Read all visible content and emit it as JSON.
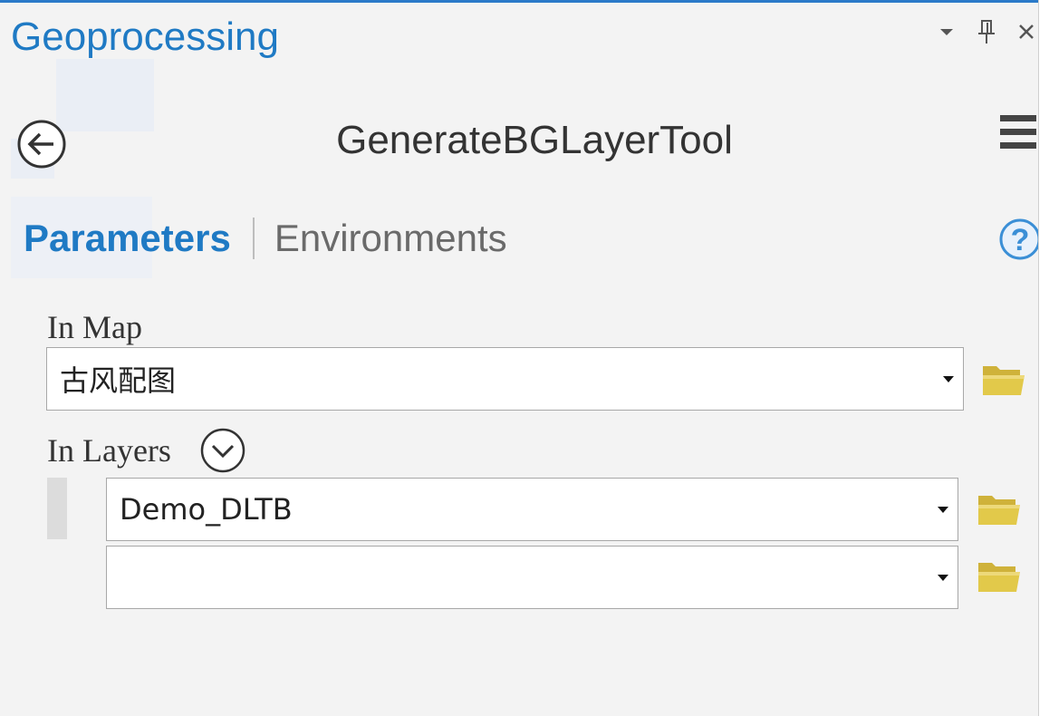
{
  "pane": {
    "title": "Geoprocessing",
    "controls": {
      "auto_hide_icon": "chevron-down-icon",
      "pin_icon": "pin-icon",
      "close_icon": "close-icon"
    },
    "accent_color": "#1f7ac4"
  },
  "tool": {
    "name": "GenerateBGLayerTool",
    "back_icon": "back-arrow-icon",
    "menu_icon": "hamburger-menu-icon"
  },
  "tabs": {
    "parameters_label": "Parameters",
    "environments_label": "Environments",
    "active": "Parameters",
    "help_icon": "help-icon"
  },
  "parameters": {
    "in_map": {
      "label": "In Map",
      "value": "古风配图"
    },
    "in_layers": {
      "label": "In Layers",
      "expand_icon": "chevron-down-circle-icon",
      "rows": [
        {
          "value": "Demo_DLTB"
        },
        {
          "value": ""
        }
      ]
    },
    "folder_icon": "folder-open-icon",
    "folder_color": "#e2c94a"
  }
}
